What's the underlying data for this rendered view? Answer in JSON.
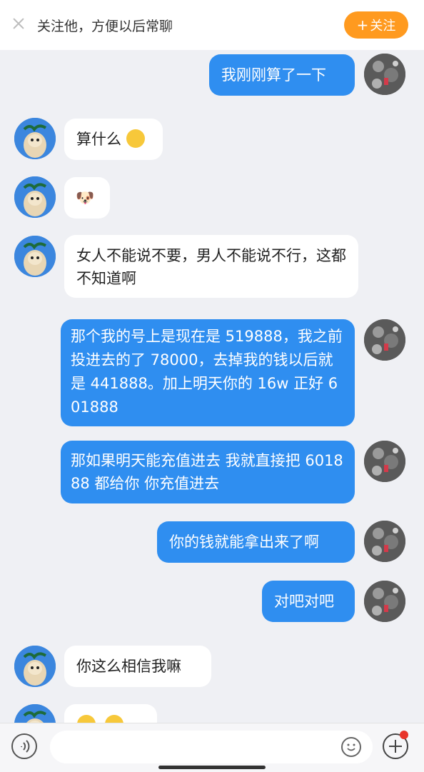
{
  "banner": {
    "text": "关注他，方便以后常聊",
    "follow_label": "关注",
    "follow_plus": "+"
  },
  "messages": [
    {
      "from": "me",
      "text": "我刚刚算了一下"
    },
    {
      "from": "other",
      "text": "算什么"
    },
    {
      "from": "other",
      "text": "🐶"
    },
    {
      "from": "other",
      "text": "女人不能说不要，男人不能说不行，这都不知道啊"
    },
    {
      "from": "me",
      "text": "那个我的号上是现在是 519888，我之前投进去的了 78000，去掉我的钱以后就是 441888。加上明天你的 16w 正好 601888"
    },
    {
      "from": "me",
      "text": "那如果明天能充值进去 我就直接把 601888 都给你 你充值进去"
    },
    {
      "from": "me",
      "text": "你的钱就能拿出来了啊"
    },
    {
      "from": "me",
      "text": "对吧对吧"
    },
    {
      "from": "other",
      "text": "你这么相信我嘛"
    }
  ],
  "colors": {
    "background": "#eff0f4",
    "outgoing_bubble": "#2f8ef0",
    "incoming_bubble": "#ffffff",
    "follow_button": "#ff9a1f"
  },
  "icons": {
    "close": "close-icon",
    "voice": "voice-icon",
    "emoji": "emoji-icon",
    "plus": "plus-icon"
  }
}
